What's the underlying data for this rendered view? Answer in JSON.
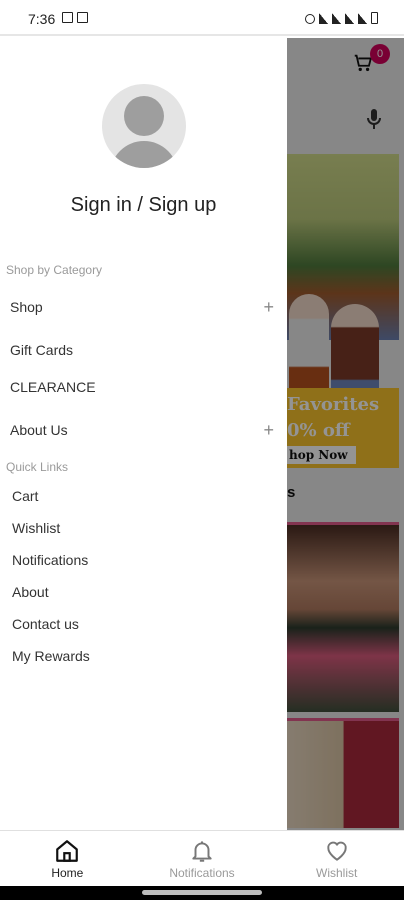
{
  "status_bar": {
    "time": "7:36"
  },
  "drawer": {
    "sign_in": "Sign in / Sign up",
    "shop_by_category_header": "Shop by Category",
    "categories": [
      {
        "label": "Shop",
        "expandable": true
      },
      {
        "label": "Gift Cards",
        "expandable": false
      },
      {
        "label": "CLEARANCE",
        "expandable": false
      },
      {
        "label": "About Us",
        "expandable": true
      }
    ],
    "quick_links_header": "Quick Links",
    "quick_links": [
      {
        "label": "Cart"
      },
      {
        "label": "Wishlist"
      },
      {
        "label": "Notifications"
      },
      {
        "label": "About"
      },
      {
        "label": "Contact us"
      },
      {
        "label": "My Rewards"
      }
    ],
    "expand_symbol": "+"
  },
  "background_app": {
    "cart_count": "0",
    "banner_line1": "Favorites",
    "banner_line2": "0% off",
    "banner_button": "hop Now",
    "section_fragment": "s",
    "accent_color": "#d1005a"
  },
  "bottom_nav": {
    "items": [
      {
        "label": "Home",
        "icon": "home-icon",
        "active": true
      },
      {
        "label": "Notifications",
        "icon": "bell-icon",
        "active": false
      },
      {
        "label": "Wishlist",
        "icon": "heart-icon",
        "active": false
      }
    ]
  }
}
